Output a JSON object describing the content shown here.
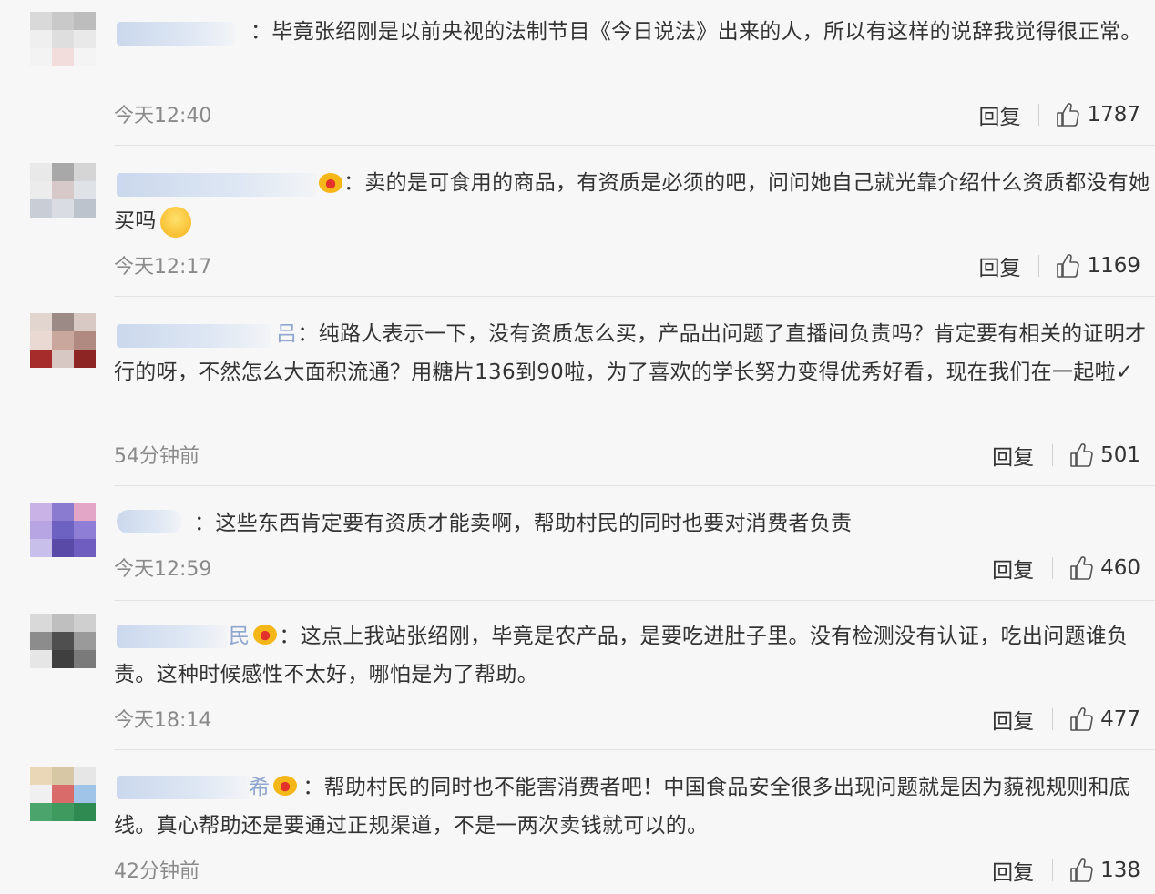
{
  "comments": [
    {
      "separator": "：",
      "text": "毕竟张绍刚是以前央视的法制节目《今日说法》出来的人，所以有这样的说辞我觉得很正常。",
      "time": "今天12:40",
      "reply": "回复",
      "likes": "1787"
    },
    {
      "separator": "：",
      "text": "卖的是可食用的商品，有资质是必须的吧，问问她自己就光靠介绍什么资质都没有她买吗",
      "time": "今天12:17",
      "reply": "回复",
      "likes": "1169"
    },
    {
      "separator": "：",
      "name_tail": "吕",
      "text": "纯路人表示一下，没有资质怎么买，产品出问题了直播间负责吗？肯定要有相关的证明才行的呀，不然怎么大面积流通？用糖片136到90啦，为了喜欢的学长努力变得优秀好看，现在我们在一起啦✓",
      "time": "54分钟前",
      "reply": "回复",
      "likes": "501"
    },
    {
      "separator": "：",
      "text": "这些东西肯定要有资质才能卖啊，帮助村民的同时也要对消费者负责",
      "time": "今天12:59",
      "reply": "回复",
      "likes": "460"
    },
    {
      "separator": "：",
      "name_tail": "民",
      "text": "这点上我站张绍刚，毕竟是农产品，是要吃进肚子里。没有检测没有认证，吃出问题谁负责。这种时候感性不太好，哪怕是为了帮助。",
      "time": "今天18:14",
      "reply": "回复",
      "likes": "477"
    },
    {
      "separator": "：",
      "name_tail": "希",
      "text": "帮助村民的同时也不能害消费者吧！中国食品安全很多出现问题就是因为藐视规则和底线。真心帮助还是要通过正规渠道，不是一两次卖钱就可以的。",
      "time": "42分钟前",
      "reply": "回复",
      "likes": "138"
    }
  ],
  "icons": {
    "like": "thumbs-up-icon",
    "badge": "crown-badge-icon",
    "emoji": "grinning-emoji-icon"
  },
  "colors": {
    "text": "#333333",
    "time": "#8a8a8a",
    "background": "#f7f7f7"
  }
}
